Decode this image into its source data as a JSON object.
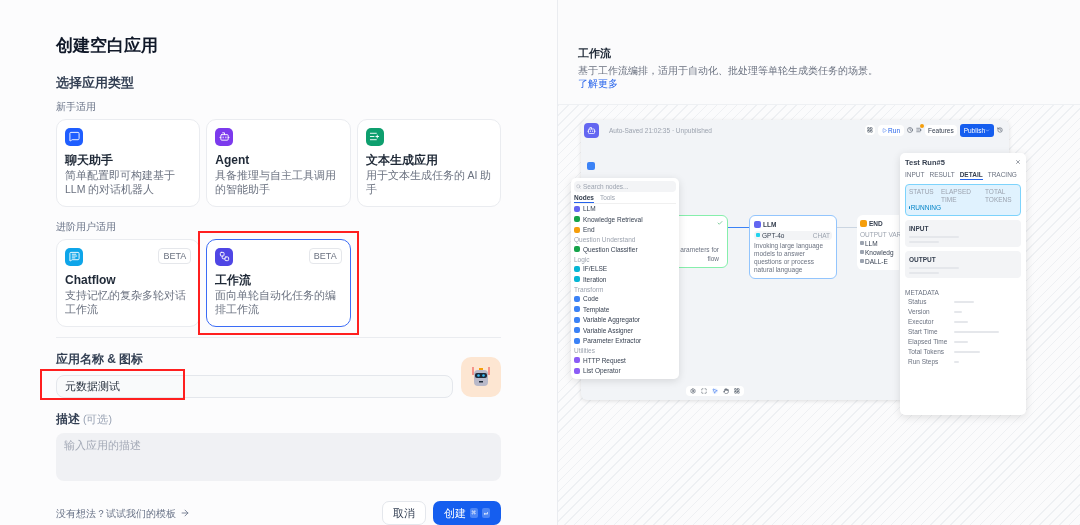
{
  "title": "创建空白应用",
  "type_section": {
    "heading": "选择应用类型",
    "groups": [
      {
        "label": "新手适用",
        "cards": [
          {
            "kind": "chat",
            "title": "聊天助手",
            "description": "简单配置即可构建基于 LLM 的对话机器人",
            "selected": false,
            "highlighted": false
          },
          {
            "kind": "agent",
            "title": "Agent",
            "description": "具备推理与自主工具调用的智能助手",
            "selected": false,
            "highlighted": false
          },
          {
            "kind": "text",
            "title": "文本生成应用",
            "description": "用于文本生成任务的 AI 助手",
            "selected": false,
            "highlighted": false
          }
        ]
      },
      {
        "label": "进阶用户适用",
        "cards": [
          {
            "kind": "chatflow",
            "title": "Chatflow",
            "description": "支持记忆的复杂多轮对话工作流",
            "badge": "BETA",
            "selected": false,
            "highlighted": false
          },
          {
            "kind": "workflow",
            "title": "工作流",
            "description": "面向单轮自动化任务的编排工作流",
            "badge": "BETA",
            "selected": true,
            "highlighted": true
          }
        ]
      }
    ]
  },
  "name_field": {
    "label": "应用名称 & 图标",
    "value": "元数据测试",
    "highlighted": true
  },
  "description_field": {
    "label": "描述",
    "optional": "(可选)",
    "placeholder": "输入应用的描述"
  },
  "template_link": "没有想法？试试我们的模板",
  "cancel_button": "取消",
  "create_button": {
    "label": "创建",
    "keys": [
      "⌘",
      "↵"
    ]
  },
  "preview": {
    "title": "工作流",
    "description": "基于工作流编排，适用于自动化、批处理等单轮生成类任务的场景。",
    "link": "了解更多",
    "editor": {
      "autosave": "Auto-Saved 21:02:35 · Unpublished",
      "run": "Run",
      "features": "Features",
      "publish": "Publish",
      "nodes_panel": {
        "search_placeholder": "Search nodes...",
        "tabs": [
          {
            "label": "Nodes",
            "selected": true
          },
          {
            "label": "Tools",
            "selected": false
          }
        ],
        "groups": [
          {
            "items": [
              {
                "label": "LLM",
                "color": "#6366f1"
              },
              {
                "label": "Knowledge Retrieval",
                "color": "#16a34a"
              },
              {
                "label": "End",
                "color": "#f59e0b"
              }
            ]
          },
          {
            "label": "Question Understand",
            "items": [
              {
                "label": "Question Classifier",
                "color": "#16a34a"
              }
            ]
          },
          {
            "label": "Logic",
            "items": [
              {
                "label": "IF/ELSE",
                "color": "#06b6d4"
              },
              {
                "label": "Iteration",
                "color": "#06b6d4"
              }
            ]
          },
          {
            "label": "Transform",
            "items": [
              {
                "label": "Code",
                "color": "#3b82f6"
              },
              {
                "label": "Template",
                "color": "#3b82f6"
              },
              {
                "label": "Variable Aggregator",
                "color": "#3b82f6"
              },
              {
                "label": "Variable Assigner",
                "color": "#3b82f6"
              },
              {
                "label": "Parameter Extractor",
                "color": "#3b82f6"
              }
            ]
          },
          {
            "label": "Utilities",
            "items": [
              {
                "label": "HTTP Request",
                "color": "#8b5cf6"
              },
              {
                "label": "List Operator",
                "color": "#8b5cf6"
              }
            ]
          }
        ]
      },
      "start_node": {
        "description": [
          "arameters for",
          "flow"
        ]
      },
      "llm_node": {
        "title": "LLM",
        "model": "GPT-4o",
        "mode": "CHAT",
        "description": "Invoking large language models to answer questions or process natural language"
      },
      "end_node": {
        "title": "END",
        "output_label": "OUTPUT VAR",
        "outputs": [
          "LLM",
          "Knowledg",
          "DALL-E"
        ]
      },
      "test_run": {
        "title": "Test Run#5",
        "tabs": [
          {
            "label": "INPUT",
            "selected": false
          },
          {
            "label": "RESULT",
            "selected": false
          },
          {
            "label": "DETAIL",
            "selected": true
          },
          {
            "label": "TRACING",
            "selected": false
          }
        ],
        "status_label": "STATUS",
        "status": "RUNNING",
        "elapsed_label": "ELAPSED TIME",
        "tokens_label": "TOTAL TOKENS",
        "input_label": "INPUT",
        "output_label": "OUTPUT",
        "metadata_label": "METADATA",
        "metadata": [
          "Status",
          "Version",
          "Executor",
          "Start Time",
          "Elapsed Time",
          "Total Tokens",
          "Run Steps"
        ]
      }
    }
  }
}
